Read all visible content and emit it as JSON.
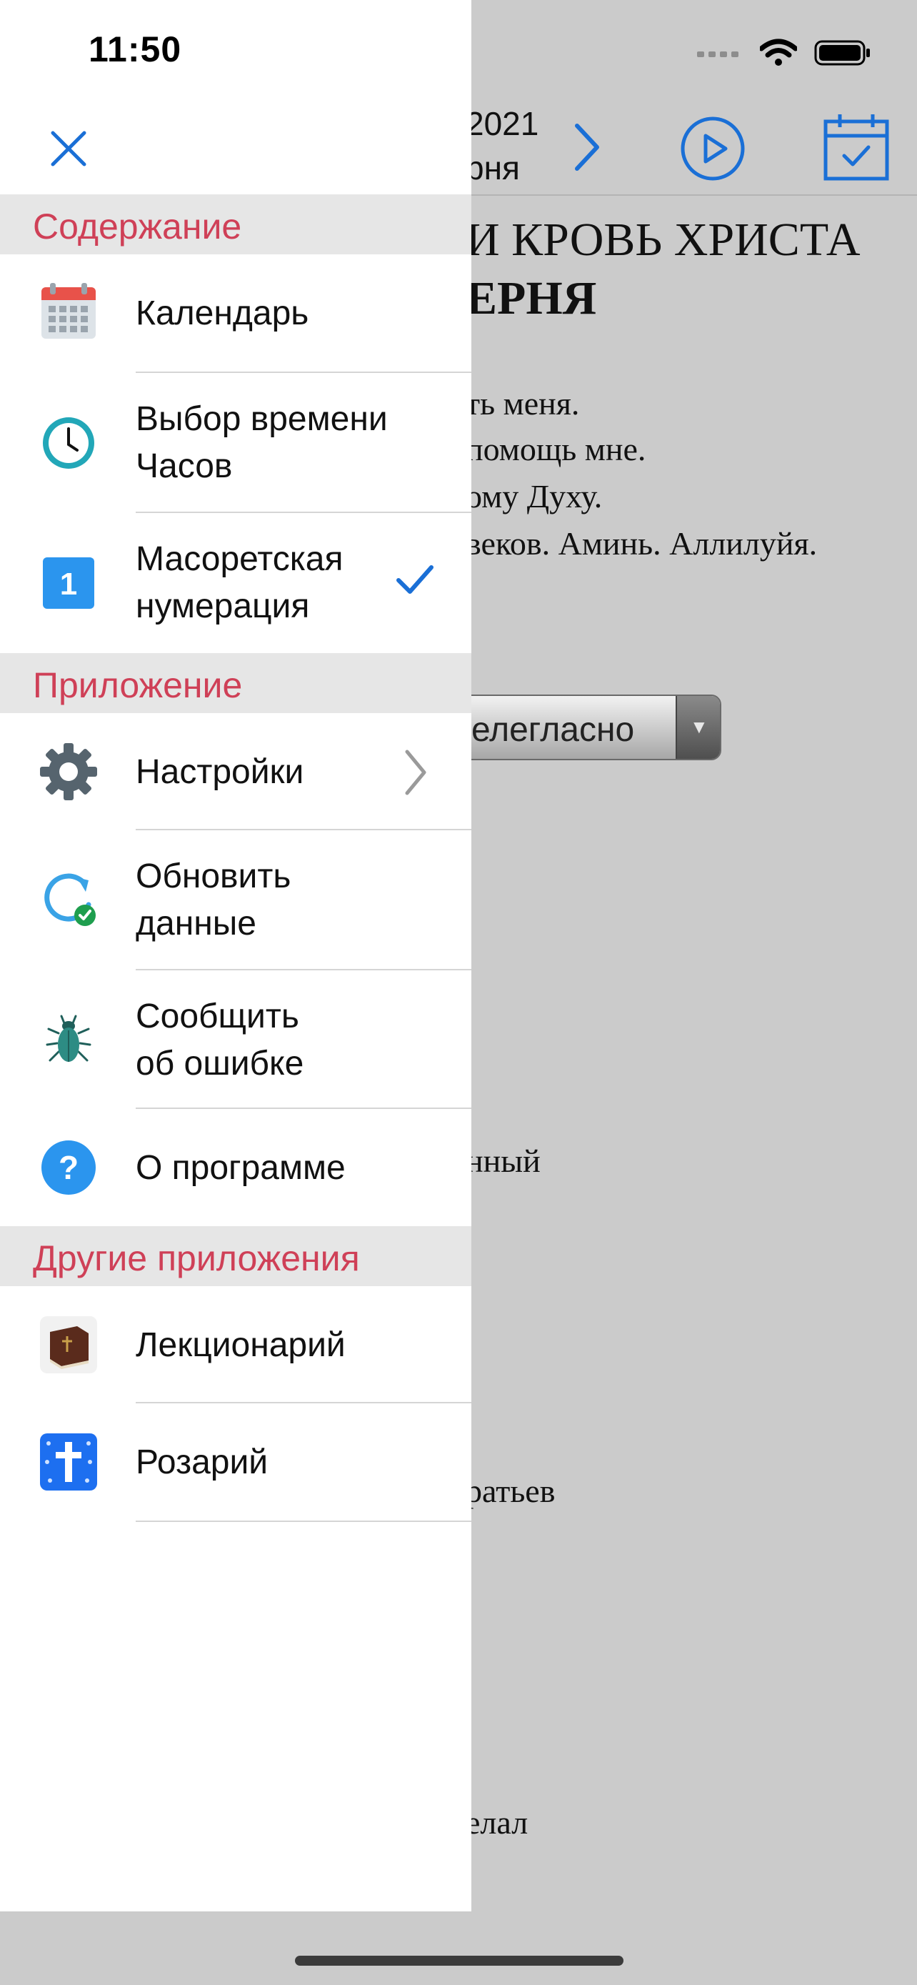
{
  "status_bar": {
    "time": "11:50"
  },
  "background_page": {
    "date_year": "2021",
    "date_month": "рня",
    "title_line1": "И КРОВЬ ХРИСТА",
    "title_line2": "ЕРНЯ",
    "lines": [
      "ть меня.",
      " помощь мне.",
      "ому Духу.",
      " веков. Аминь. Аллилуйя."
    ],
    "dropdown_value": "елегласно",
    "lower_fragments": [
      "нный",
      "ратьев",
      "елал"
    ]
  },
  "drawer": {
    "sections": [
      {
        "title": "Содержание",
        "items": [
          {
            "label": "Календарь",
            "icon": "calendar-icon"
          },
          {
            "label": "Выбор времени\nЧасов",
            "icon": "clock-icon"
          },
          {
            "label": "Масоретская\nнумерация",
            "icon": "number-one-icon",
            "checked": true
          }
        ]
      },
      {
        "title": "Приложение",
        "items": [
          {
            "label": "Настройки",
            "icon": "gear-icon",
            "chevron": true
          },
          {
            "label": "Обновить\nданные",
            "icon": "refresh-icon"
          },
          {
            "label": "Сообщить\nоб ошибке",
            "icon": "bug-icon"
          },
          {
            "label": "О программе",
            "icon": "question-icon"
          }
        ]
      },
      {
        "title": "Другие приложения",
        "items": [
          {
            "label": "Лекционарий",
            "icon": "book-icon"
          },
          {
            "label": "Розарий",
            "icon": "cross-app-icon"
          }
        ]
      }
    ]
  },
  "colors": {
    "accent": "#1a6fd6",
    "section_title": "#cf4057",
    "section_bg": "#e6e6e6",
    "backdrop": "#cbcbcb"
  }
}
